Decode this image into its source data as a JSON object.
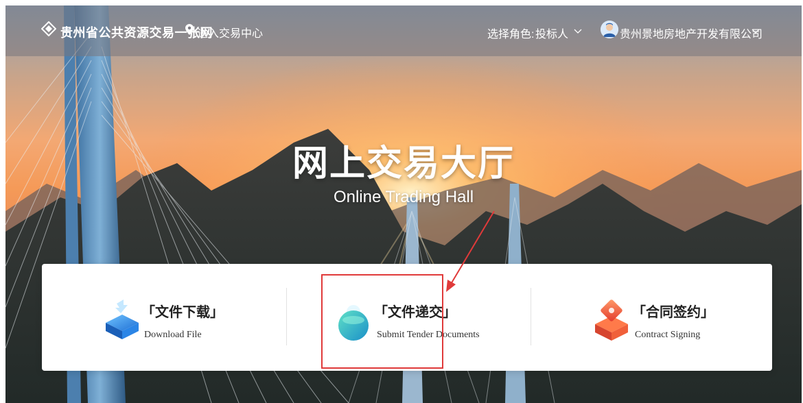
{
  "header": {
    "site_title": "贵州省公共资源交易一张网",
    "enter_center": "进入交易中心",
    "role_label": "选择角色:",
    "role_value": "投标人",
    "company_name": "贵州景地房地产开发有限公司"
  },
  "hero": {
    "title": "网上交易大厅",
    "subtitle": "Online Trading Hall"
  },
  "cards": [
    {
      "title": "「文件下载」",
      "subtitle": "Download File",
      "icon": "download-file-icon"
    },
    {
      "title": "「文件递交」",
      "subtitle": "Submit Tender Documents",
      "icon": "submit-documents-icon"
    },
    {
      "title": "「合同签约」",
      "subtitle": "Contract Signing",
      "icon": "contract-signing-icon"
    }
  ],
  "annotation": {
    "highlight_color": "#e03a3a",
    "highlighted_card": "「文件递交」"
  },
  "colors": {
    "accent_blue": "#1f7bd8",
    "accent_teal": "#1aa39a",
    "accent_red": "#e8452f"
  }
}
